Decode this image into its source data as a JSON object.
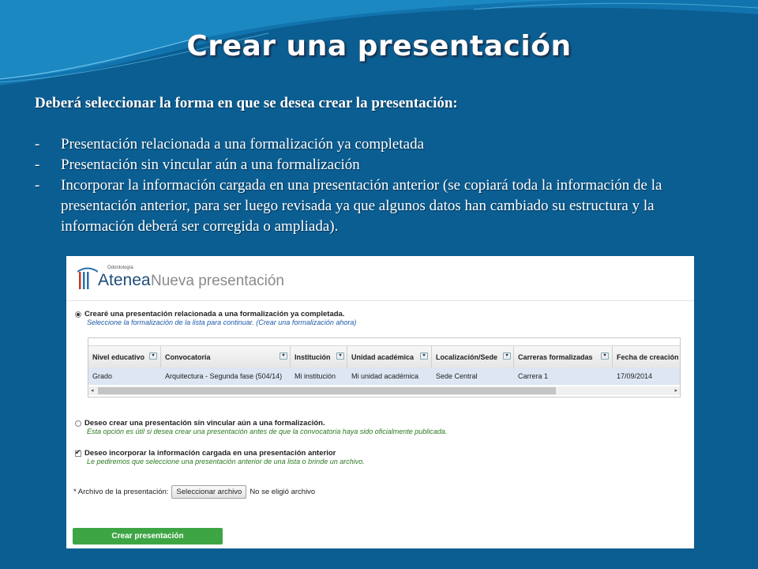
{
  "slide": {
    "title": "Crear una presentación",
    "lead": "Deberá seleccionar la forma en que se desea crear la presentación:",
    "bullets": [
      "Presentación relacionada a una formalización ya completada",
      "Presentación sin vincular aún a una formalización",
      "Incorporar la información cargada en una presentación anterior (se copiará toda la información de la presentación anterior, para ser luego revisada ya que algunos datos han cambiado su estructura y la información deberá ser corregida o ampliada)."
    ],
    "bullet_marker": "-"
  },
  "app": {
    "logo_small": "Odontología",
    "logo_name": "Atenea",
    "page_title": "Nueva presentación",
    "option1": {
      "label": "Crearé una presentación relacionada a una formalización ya completada.",
      "note": "Seleccione la formalización de la lista para continuar.",
      "link": "(Crear una formalización ahora)",
      "selected": true
    },
    "table": {
      "columns": [
        "Nivel educativo",
        "Convocatoria",
        "Institución",
        "Unidad académica",
        "Localización/Sede",
        "Carreras formalizadas",
        "Fecha de creación"
      ],
      "rows": [
        [
          "Grado",
          "Arquitectura - Segunda fase (504/14)",
          "Mi institución",
          "Mi unidad académica",
          "Sede Central",
          "Carrera 1",
          "17/09/2014"
        ]
      ]
    },
    "option2": {
      "label": "Deseo crear una presentación sin vincular aún a una formalización.",
      "note": "Esta opción es útil si desea crear una presentación antes de que la convocatoria haya sido oficialmente publicada.",
      "selected": false
    },
    "option3": {
      "label": "Deseo incorporar la información cargada en una presentación anterior",
      "note": "Le pediremos que seleccione una presentación anterior de una lista o brinde un archivo.",
      "checked": true
    },
    "file": {
      "label": "* Archivo de la presentación:",
      "button": "Seleccionar archivo",
      "status": "No se eligió archivo"
    },
    "create_button": "Crear presentación"
  },
  "colors": {
    "slide_background": "#0b5e92",
    "create_button": "#3ea544",
    "note_green": "#2a7a1f",
    "note_blue": "#1e5aa8"
  },
  "icons": [
    "radio-icon",
    "checkbox-icon",
    "sort-dropdown-icon",
    "scroll-left-icon",
    "scroll-right-icon",
    "atenea-logo-icon"
  ]
}
